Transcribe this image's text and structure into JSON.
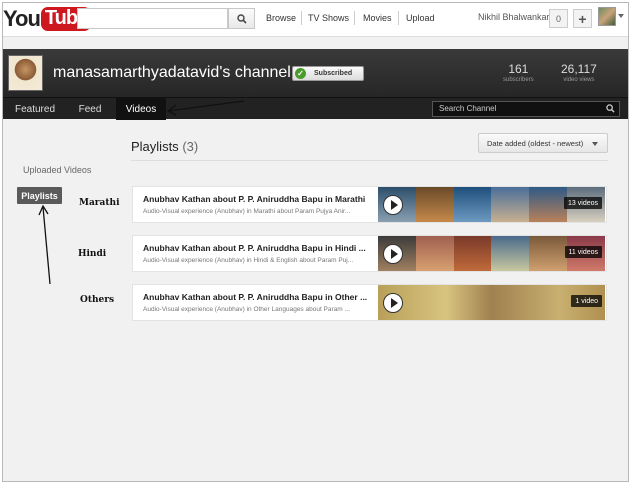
{
  "masthead": {
    "logo_you": "You",
    "logo_tube": "Tube",
    "nav": [
      "Browse",
      "TV Shows",
      "Movies",
      "Upload"
    ],
    "user_name": "Nikhil Bhalwankar",
    "notifications": "0",
    "plus": "+"
  },
  "channel": {
    "title": "manasamarthyadatavid's channel",
    "subscribed_label": "Subscribed",
    "subscribers": "161",
    "subscribers_label": "subscribers",
    "views": "26,117",
    "views_label": "video views"
  },
  "tabs": {
    "items": [
      "Featured",
      "Feed",
      "Videos"
    ],
    "active": "Videos",
    "search_placeholder": "Search Channel"
  },
  "sidebar": {
    "uploaded_videos": "Uploaded Videos",
    "playlists": "Playlists"
  },
  "main": {
    "heading": "Playlists",
    "count": "(3)",
    "sort": "Date added (oldest - newest)"
  },
  "annotations": {
    "marathi": "Marathi",
    "hindi": "Hindi",
    "others": "Others"
  },
  "playlists": [
    {
      "title": "Anubhav Kathan about P. P. Aniruddha Bapu in Marathi",
      "description": "Audio-Visual experience (Anubhav) in Marathi about Param Pujya Anir...",
      "count": "13 videos"
    },
    {
      "title": "Anubhav Kathan about P. P. Aniruddha Bapu in Hindi ...",
      "description": "Audio-Visual experience (Anubhav) in Hindi & English about Param Puj...",
      "count": "11 videos"
    },
    {
      "title": "Anubhav Kathan about P. P. Aniruddha Bapu in Other ...",
      "description": "Audio-Visual experience (Anubhav) in Other Languages about Param ...",
      "count": "1 video"
    }
  ],
  "colors": {
    "logo_red": "#cc181e",
    "subscribed_check": "#4a9a2c",
    "channel_header": "#2b2b2b"
  }
}
